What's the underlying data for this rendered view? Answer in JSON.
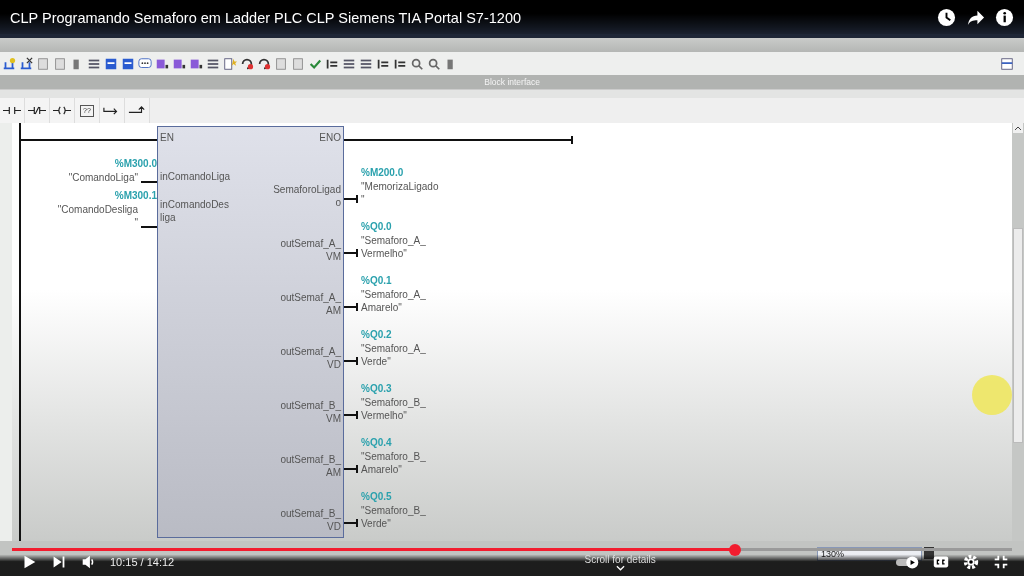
{
  "video": {
    "title": "CLP Programando Semaforo em Ladder PLC CLP Siemens TIA Portal S7-1200",
    "time": "10:15 / 14:12",
    "hint": "Scroll for details",
    "progress": {
      "level": 0.723
    }
  },
  "panel": {
    "title": "Block interface"
  },
  "instructions": [
    {
      "kind": "no-contact"
    },
    {
      "kind": "nc-contact"
    },
    {
      "kind": "coil"
    },
    {
      "kind": "box",
      "label": "??"
    },
    {
      "kind": "open-branch"
    },
    {
      "kind": "close-branch"
    }
  ],
  "block": {
    "en": "EN",
    "eno": "ENO",
    "inputs": [
      {
        "pin": [
          "inComandoLiga"
        ],
        "address": "%M300.0",
        "tag": [
          "\"ComandoLiga\""
        ]
      },
      {
        "pin": [
          "inComandoDes",
          "liga"
        ],
        "address": "%M300.1",
        "tag": [
          "\"ComandoDesliga",
          "\""
        ]
      }
    ],
    "outputs": [
      {
        "pin": [
          "SemaforoLigad",
          "o"
        ],
        "address": "%M200.0",
        "tag": [
          "\"MemorizaLigado",
          "\""
        ]
      },
      {
        "pin": [
          "outSemaf_A_",
          "VM"
        ],
        "address": "%Q0.0",
        "tag": [
          "\"Semaforo_A_",
          "Vermelho\""
        ]
      },
      {
        "pin": [
          "outSemaf_A_",
          "AM"
        ],
        "address": "%Q0.1",
        "tag": [
          "\"Semaforo_A_",
          "Amarelo\""
        ]
      },
      {
        "pin": [
          "outSemaf_A_",
          "VD"
        ],
        "address": "%Q0.2",
        "tag": [
          "\"Semaforo_A_",
          "Verde\""
        ]
      },
      {
        "pin": [
          "outSemaf_B_",
          "VM"
        ],
        "address": "%Q0.3",
        "tag": [
          "\"Semaforo_B_",
          "Vermelho\""
        ]
      },
      {
        "pin": [
          "outSemaf_B_",
          "AM"
        ],
        "address": "%Q0.4",
        "tag": [
          "\"Semaforo_B_",
          "Amarelo\""
        ]
      },
      {
        "pin": [
          "outSemaf_B_",
          "VD"
        ],
        "address": "%Q0.5",
        "tag": [
          "\"Semaforo_B_",
          "Verde\""
        ]
      }
    ]
  },
  "zoom": {
    "value": "130%"
  }
}
